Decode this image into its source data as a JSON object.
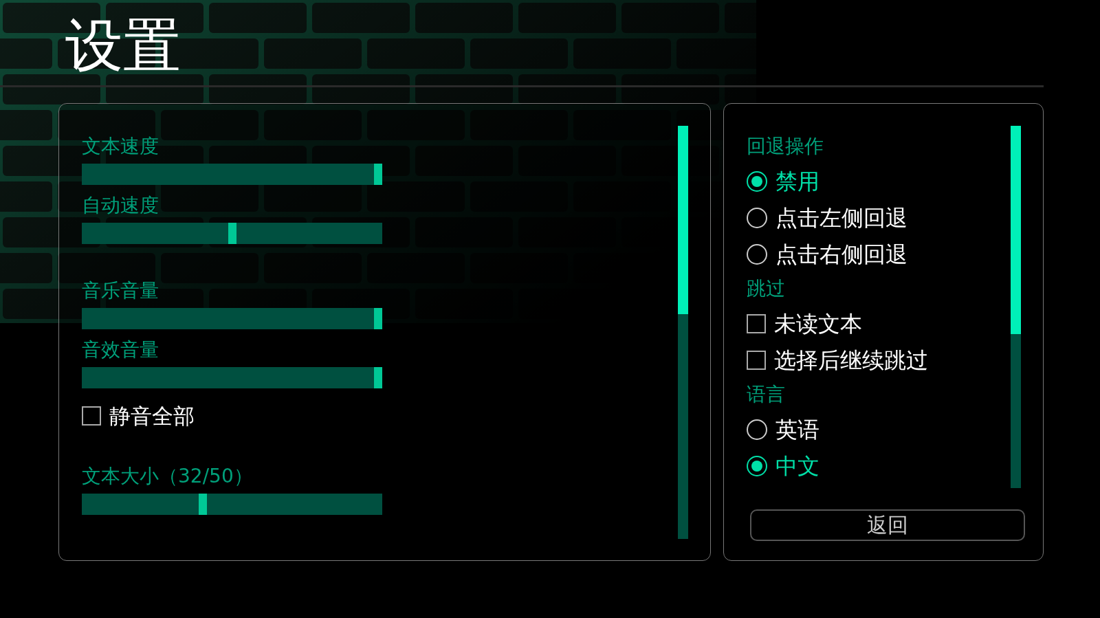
{
  "title": "设置",
  "left_panel": {
    "groups": [
      {
        "items": [
          {
            "kind": "slider",
            "label": "文本速度",
            "level": 1
          },
          {
            "kind": "slider",
            "label": "自动速度",
            "level": 0.5
          }
        ]
      },
      {
        "items": [
          {
            "kind": "slider",
            "label": "音乐音量",
            "level": 1
          },
          {
            "kind": "slider",
            "label": "音效音量",
            "level": 1
          },
          {
            "kind": "checkbox",
            "label": "静音全部",
            "checked": false
          }
        ]
      },
      {
        "items": [
          {
            "kind": "slider",
            "label": "文本大小（32/50）",
            "level": 0.4
          }
        ]
      }
    ]
  },
  "right_panel": {
    "groups": [
      {
        "label": "回退操作",
        "kind": "radio",
        "options": [
          {
            "label": "禁用",
            "selected": true
          },
          {
            "label": "点击左侧回退",
            "selected": false
          },
          {
            "label": "点击右侧回退",
            "selected": false
          }
        ]
      },
      {
        "label": "跳过",
        "kind": "checkbox",
        "options": [
          {
            "label": "未读文本",
            "checked": false
          },
          {
            "label": "选择后继续跳过",
            "checked": false
          }
        ]
      },
      {
        "label": "语言",
        "kind": "radio",
        "options": [
          {
            "label": "英语",
            "selected": false
          },
          {
            "label": "中文",
            "selected": true
          }
        ]
      }
    ],
    "back_button": "返回"
  }
}
